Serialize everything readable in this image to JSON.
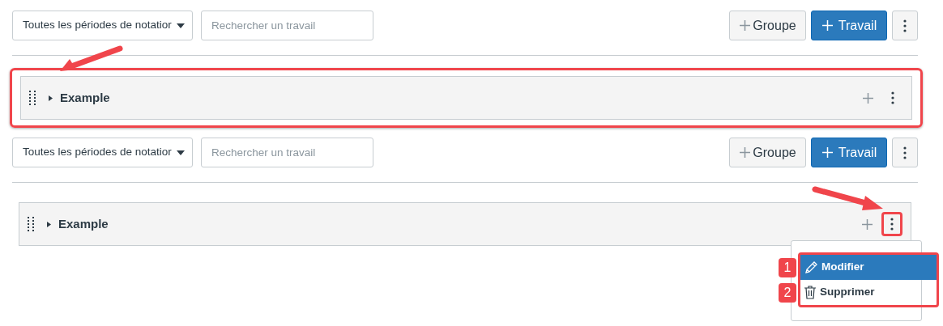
{
  "panels": [
    {
      "toolbar": {
        "period_select": "Toutes les périodes de notatior",
        "search": {
          "placeholder": "Rechercher un travail"
        },
        "buttons": [
          {
            "kind": "group",
            "label": "Groupe"
          },
          {
            "kind": "assignment",
            "label": "Travail"
          },
          {
            "kind": "more"
          }
        ]
      },
      "group": {
        "title": "Example",
        "expanded": false,
        "highlighted": true,
        "menu_highlighted": false
      }
    },
    {
      "toolbar": {
        "period_select": "Toutes les périodes de notatior",
        "search": {
          "placeholder": "Rechercher un travail"
        },
        "buttons": [
          {
            "kind": "group",
            "label": "Groupe"
          },
          {
            "kind": "assignment",
            "label": "Travail"
          },
          {
            "kind": "more"
          }
        ]
      },
      "group": {
        "title": "Example",
        "expanded": false,
        "highlighted": false,
        "menu_highlighted": true
      },
      "menu": {
        "highlighted": true,
        "items": [
          {
            "kind": "edit",
            "label": "Modifier",
            "badge": "1",
            "selected": true
          },
          {
            "kind": "delete",
            "label": "Supprimer",
            "badge": "2",
            "selected": false
          }
        ]
      }
    }
  ]
}
